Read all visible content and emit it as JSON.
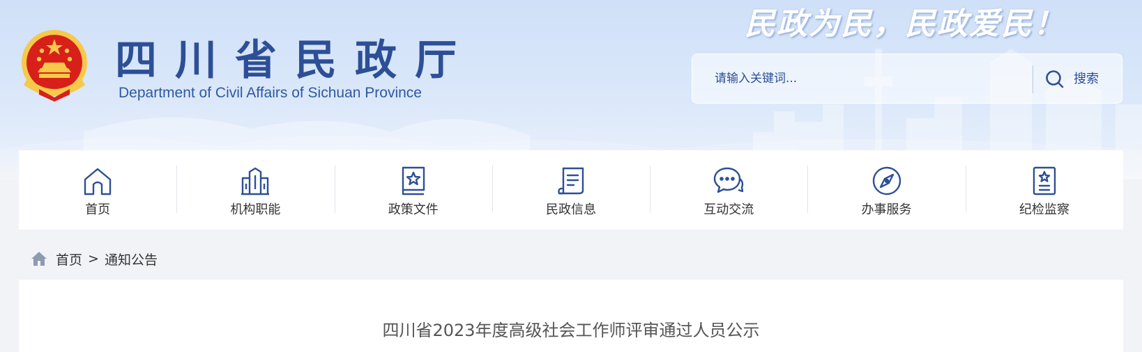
{
  "header": {
    "title": "四川省民政厅",
    "title_en": "Department of Civil Affairs of Sichuan Province",
    "slogan": "民政为民，民政爱民！"
  },
  "search": {
    "placeholder": "请输入关键词...",
    "button_label": "搜索"
  },
  "nav": {
    "items": [
      {
        "label": "首页",
        "icon": "home-icon"
      },
      {
        "label": "机构职能",
        "icon": "building-icon"
      },
      {
        "label": "政策文件",
        "icon": "document-star-icon"
      },
      {
        "label": "民政信息",
        "icon": "scroll-icon"
      },
      {
        "label": "互动交流",
        "icon": "chat-bubbles-icon"
      },
      {
        "label": "办事服务",
        "icon": "compass-icon"
      },
      {
        "label": "纪检监察",
        "icon": "badge-star-icon"
      }
    ]
  },
  "breadcrumb": {
    "home": "首页",
    "separator": ">",
    "current": "通知公告"
  },
  "article": {
    "title": "四川省2023年度高级社会工作师评审通过人员公示"
  },
  "colors": {
    "brand_blue": "#2d4f96",
    "emblem_red": "#d7201a",
    "emblem_gold": "#f6c94a",
    "page_bg": "#f1f3f7"
  }
}
